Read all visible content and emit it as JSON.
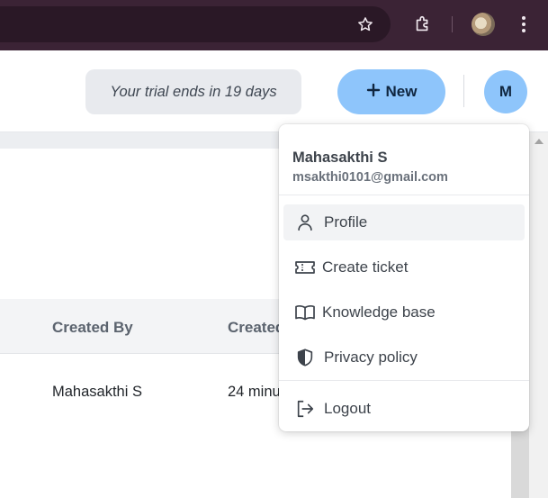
{
  "app": {
    "trial_text": "Your trial ends in 19 days",
    "new_button": {
      "icon": "plus-icon",
      "label": "New"
    },
    "avatar_initial": "M"
  },
  "browser": {
    "icons": [
      "star-icon",
      "extensions-icon",
      "profile-photo",
      "more-vert-icon"
    ]
  },
  "table": {
    "headers": {
      "created_by": "Created By",
      "created": "Created"
    },
    "rows": [
      {
        "created_by": "Mahasakthi S",
        "created": "24 minu"
      }
    ]
  },
  "account_menu": {
    "name": "Mahasakthi S",
    "email": "msakthi0101@gmail.com",
    "items": [
      {
        "label": "Profile",
        "icon": "person-icon",
        "active": true
      },
      {
        "label": "Create ticket",
        "icon": "ticket-icon"
      },
      {
        "label": "Knowledge base",
        "icon": "book-icon"
      },
      {
        "label": "Privacy policy",
        "icon": "shield-icon"
      },
      {
        "label": "Logout",
        "icon": "logout-icon"
      }
    ]
  },
  "colors": {
    "accent": "#8ec5fb",
    "browser_chrome": "#3b2335"
  }
}
